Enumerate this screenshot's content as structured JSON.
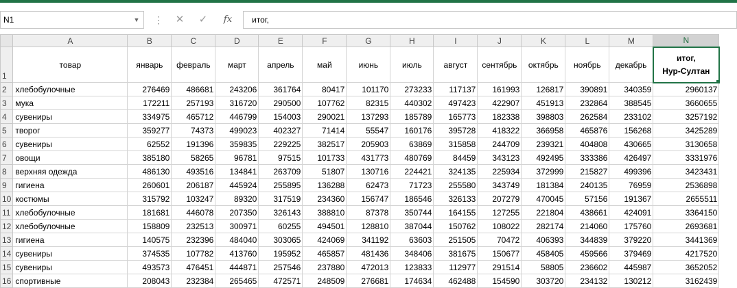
{
  "namebox": {
    "value": "N1"
  },
  "formula_bar": {
    "value": "итог,"
  },
  "columns": [
    "A",
    "B",
    "C",
    "D",
    "E",
    "F",
    "G",
    "H",
    "I",
    "J",
    "K",
    "L",
    "M",
    "N"
  ],
  "header_row": {
    "row_number": "1",
    "cells": [
      "товар",
      "январь",
      "февраль",
      "март",
      "апрель",
      "май",
      "июнь",
      "июль",
      "август",
      "сентябрь",
      "октябрь",
      "ноябрь",
      "декабрь"
    ],
    "total_line1": "итог,",
    "total_line2": "Нур-Султан"
  },
  "rows": [
    {
      "n": "2",
      "cells": [
        "хлебобулочные",
        "276469",
        "486681",
        "243206",
        "361764",
        "80417",
        "101170",
        "273233",
        "117137",
        "161993",
        "126817",
        "390891",
        "340359",
        "2960137"
      ]
    },
    {
      "n": "3",
      "cells": [
        "мука",
        "172211",
        "257193",
        "316720",
        "290500",
        "107762",
        "82315",
        "440302",
        "497423",
        "422907",
        "451913",
        "232864",
        "388545",
        "3660655"
      ]
    },
    {
      "n": "4",
      "cells": [
        "сувениры",
        "334975",
        "465712",
        "446799",
        "154003",
        "290021",
        "137293",
        "185789",
        "165773",
        "182338",
        "398803",
        "262584",
        "233102",
        "3257192"
      ]
    },
    {
      "n": "5",
      "cells": [
        "творог",
        "359277",
        "74373",
        "499023",
        "402327",
        "71414",
        "55547",
        "160176",
        "395728",
        "418322",
        "366958",
        "465876",
        "156268",
        "3425289"
      ]
    },
    {
      "n": "6",
      "cells": [
        "сувениры",
        "62552",
        "191396",
        "359835",
        "229225",
        "382517",
        "205903",
        "63869",
        "315858",
        "244709",
        "239321",
        "404808",
        "430665",
        "3130658"
      ]
    },
    {
      "n": "7",
      "cells": [
        "овощи",
        "385180",
        "58265",
        "96781",
        "97515",
        "101733",
        "431773",
        "480769",
        "84459",
        "343123",
        "492495",
        "333386",
        "426497",
        "3331976"
      ]
    },
    {
      "n": "8",
      "cells": [
        "верхняя одежда",
        "486130",
        "493516",
        "134841",
        "263709",
        "51807",
        "130716",
        "224421",
        "324135",
        "225934",
        "372999",
        "215827",
        "499396",
        "3423431"
      ]
    },
    {
      "n": "9",
      "cells": [
        "гигиена",
        "260601",
        "206187",
        "445924",
        "255895",
        "136288",
        "62473",
        "71723",
        "255580",
        "343749",
        "181384",
        "240135",
        "76959",
        "2536898"
      ]
    },
    {
      "n": "10",
      "cells": [
        "костюмы",
        "315792",
        "103247",
        "89320",
        "317519",
        "234360",
        "156747",
        "186546",
        "326133",
        "207279",
        "470045",
        "57156",
        "191367",
        "2655511"
      ]
    },
    {
      "n": "11",
      "cells": [
        "хлебобулочные",
        "181681",
        "446078",
        "207350",
        "326143",
        "388810",
        "87378",
        "350744",
        "164155",
        "127255",
        "221804",
        "438661",
        "424091",
        "3364150"
      ]
    },
    {
      "n": "12",
      "cells": [
        "хлебобулочные",
        "158809",
        "232513",
        "300971",
        "60255",
        "494501",
        "128810",
        "387044",
        "150762",
        "108022",
        "282174",
        "214060",
        "175760",
        "2693681"
      ]
    },
    {
      "n": "13",
      "cells": [
        "гигиена",
        "140575",
        "232396",
        "484040",
        "303065",
        "424069",
        "341192",
        "63603",
        "251505",
        "70472",
        "406393",
        "344839",
        "379220",
        "3441369"
      ]
    },
    {
      "n": "14",
      "cells": [
        "сувениры",
        "374535",
        "107782",
        "413760",
        "195952",
        "465857",
        "481436",
        "348406",
        "381675",
        "150677",
        "458405",
        "459566",
        "379469",
        "4217520"
      ]
    },
    {
      "n": "15",
      "cells": [
        "сувениры",
        "493573",
        "476451",
        "444871",
        "257546",
        "237880",
        "472013",
        "123833",
        "112977",
        "291514",
        "58805",
        "236602",
        "445987",
        "3652052"
      ]
    },
    {
      "n": "16",
      "cells": [
        "спортивные",
        "208043",
        "232384",
        "265465",
        "472571",
        "248509",
        "276681",
        "174634",
        "462488",
        "154590",
        "303720",
        "234132",
        "130212",
        "3162439"
      ]
    }
  ]
}
